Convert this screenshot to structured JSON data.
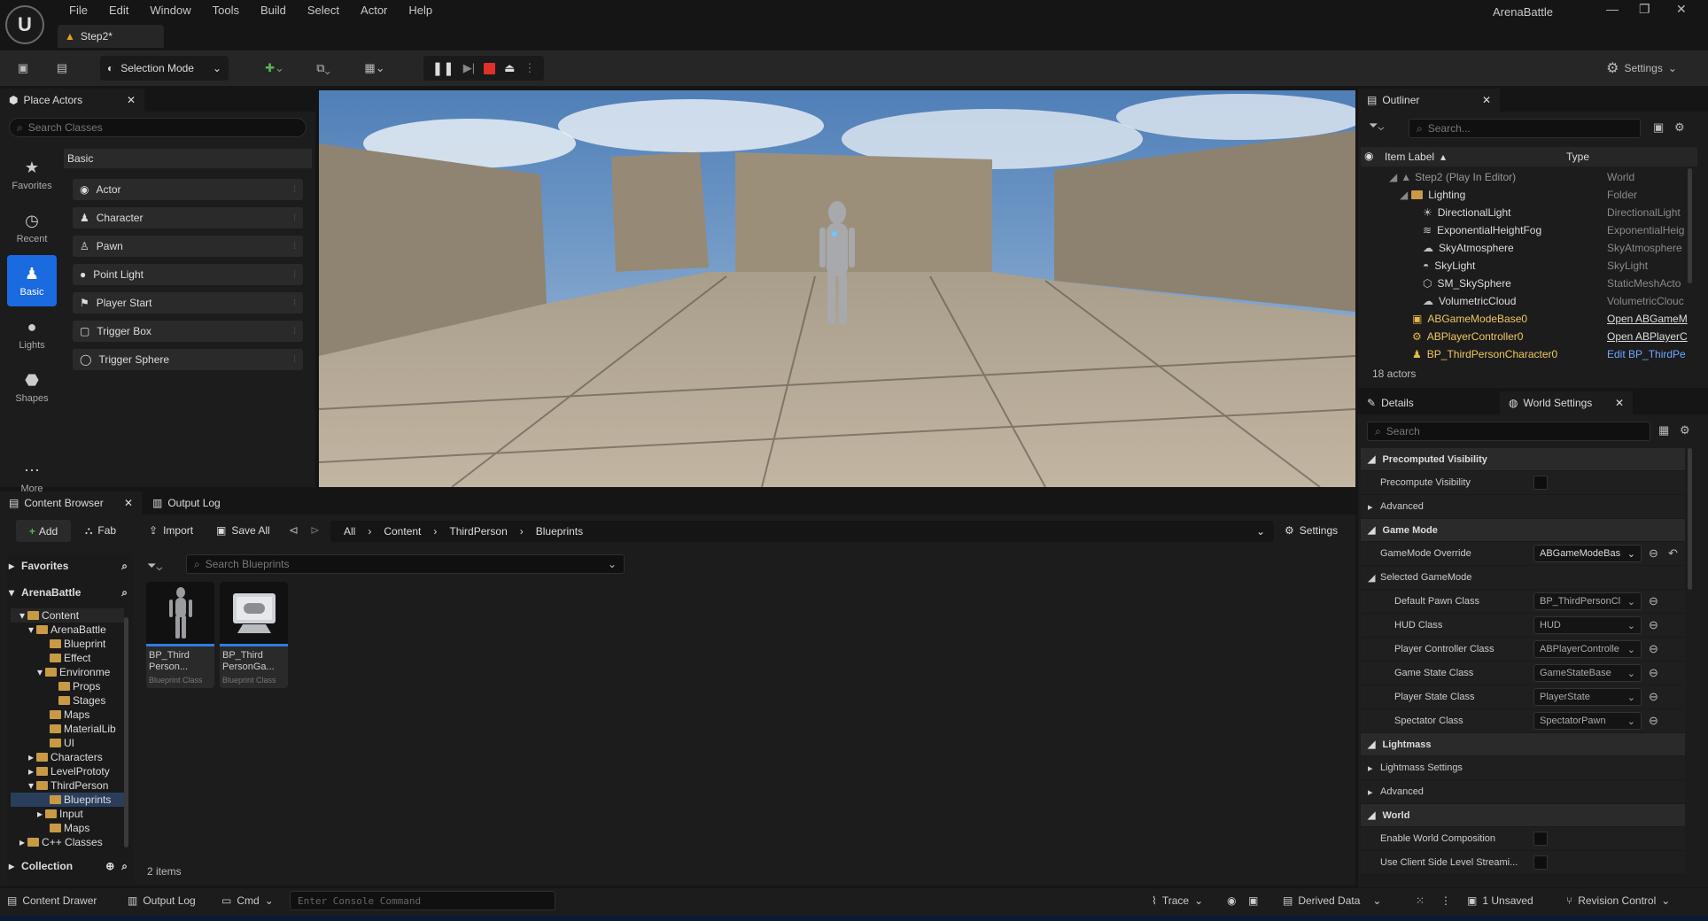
{
  "menubar": {
    "logo_text": "U",
    "items": [
      "File",
      "Edit",
      "Window",
      "Tools",
      "Build",
      "Select",
      "Actor",
      "Help"
    ],
    "app_name": "ArenaBattle",
    "window_controls": {
      "minimize": "—",
      "maximize": "❐",
      "close": "✕"
    }
  },
  "doc_tab": {
    "label": "Step2*"
  },
  "toolbar": {
    "selection_mode": "Selection Mode",
    "settings": "Settings"
  },
  "place_actors": {
    "tab": "Place Actors",
    "search_placeholder": "Search Classes",
    "section": "Basic",
    "categories": [
      {
        "label": "Favorites",
        "icon": "star-icon"
      },
      {
        "label": "Recent",
        "icon": "clock-icon"
      },
      {
        "label": "Basic",
        "icon": "basic-shapes-icon"
      },
      {
        "label": "Lights",
        "icon": "bulb-icon"
      },
      {
        "label": "Shapes",
        "icon": "cube-icon"
      },
      {
        "label": "More",
        "icon": "more-icon"
      }
    ],
    "items": [
      "Actor",
      "Character",
      "Pawn",
      "Point Light",
      "Player Start",
      "Trigger Box",
      "Trigger Sphere"
    ]
  },
  "outliner": {
    "tab": "Outliner",
    "search_placeholder": "Search...",
    "col_label": "Item Label",
    "col_type": "Type",
    "rows": [
      {
        "label": "Step2 (Play In Editor)",
        "type": "World"
      },
      {
        "label": "Lighting",
        "type": "Folder"
      },
      {
        "label": "DirectionalLight",
        "type": "DirectionalLight"
      },
      {
        "label": "ExponentialHeightFog",
        "type": "ExponentialHeig"
      },
      {
        "label": "SkyAtmosphere",
        "type": "SkyAtmosphere"
      },
      {
        "label": "SkyLight",
        "type": "SkyLight"
      },
      {
        "label": "SM_SkySphere",
        "type": "StaticMeshActo"
      },
      {
        "label": "VolumetricCloud",
        "type": "VolumetricClouc"
      },
      {
        "label": "ABGameModeBase0",
        "type": "Open ABGameM"
      },
      {
        "label": "ABPlayerController0",
        "type": "Open ABPlayerC"
      },
      {
        "label": "BP_ThirdPersonCharacter0",
        "type": "Edit BP_ThirdPe"
      }
    ],
    "count": "18 actors"
  },
  "details": {
    "tab_details": "Details",
    "tab_world": "World Settings",
    "search_placeholder": "Search",
    "sections": {
      "precomputed": "Precomputed Visibility",
      "precompute_vis": "Precompute Visibility",
      "advanced": "Advanced",
      "game_mode": "Game Mode",
      "gm_override": "GameMode Override",
      "gm_override_val": "ABGameModeBas",
      "selected_gm": "Selected GameMode",
      "lightmass": "Lightmass",
      "lightmass_settings": "Lightmass Settings",
      "advanced2": "Advanced",
      "world": "World",
      "enable_world_comp": "Enable World Composition",
      "client_side": "Use Client Side Level Streami..."
    },
    "classes": [
      {
        "label": "Default Pawn Class",
        "value": "BP_ThirdPersonCl"
      },
      {
        "label": "HUD Class",
        "value": "HUD"
      },
      {
        "label": "Player Controller Class",
        "value": "ABPlayerControlle"
      },
      {
        "label": "Game State Class",
        "value": "GameStateBase"
      },
      {
        "label": "Player State Class",
        "value": "PlayerState"
      },
      {
        "label": "Spectator Class",
        "value": "SpectatorPawn"
      }
    ]
  },
  "content_browser": {
    "tab": "Content Browser",
    "tab_output": "Output Log",
    "add": "Add",
    "fab": "Fab",
    "import": "Import",
    "save_all": "Save All",
    "path": [
      "All",
      "Content",
      "ThirdPerson",
      "Blueprints"
    ],
    "settings": "Settings",
    "favorites": "Favorites",
    "project": "ArenaBattle",
    "search_placeholder": "Search Blueprints",
    "tree": [
      {
        "label": "Content",
        "depth": 0,
        "open": true
      },
      {
        "label": "ArenaBattle",
        "depth": 1,
        "open": true
      },
      {
        "label": "Blueprint",
        "depth": 2
      },
      {
        "label": "Effect",
        "depth": 2
      },
      {
        "label": "Environme",
        "depth": 2,
        "open": true
      },
      {
        "label": "Props",
        "depth": 3
      },
      {
        "label": "Stages",
        "depth": 3
      },
      {
        "label": "Maps",
        "depth": 2
      },
      {
        "label": "MaterialLib",
        "depth": 2
      },
      {
        "label": "UI",
        "depth": 2
      },
      {
        "label": "Characters",
        "depth": 1,
        "closed": true
      },
      {
        "label": "LevelPrototy",
        "depth": 1,
        "closed": true
      },
      {
        "label": "ThirdPerson",
        "depth": 1,
        "open": true
      },
      {
        "label": "Blueprints",
        "depth": 2,
        "selected": true
      },
      {
        "label": "Input",
        "depth": 2,
        "closed": true
      },
      {
        "label": "Maps",
        "depth": 2
      },
      {
        "label": "C++ Classes",
        "depth": 0,
        "closed": true
      }
    ],
    "collection": "Collection",
    "assets": [
      {
        "name": "BP_Third Person...",
        "cls": "Blueprint Class"
      },
      {
        "name": "BP_Third PersonGa...",
        "cls": "Blueprint Class"
      }
    ],
    "items_count": "2 items"
  },
  "statusbar": {
    "content_drawer": "Content Drawer",
    "output_log": "Output Log",
    "cmd": "Cmd",
    "console_placeholder": "Enter Console Command",
    "trace": "Trace",
    "derived_data": "Derived Data",
    "unsaved": "1 Unsaved",
    "revision": "Revision Control"
  }
}
